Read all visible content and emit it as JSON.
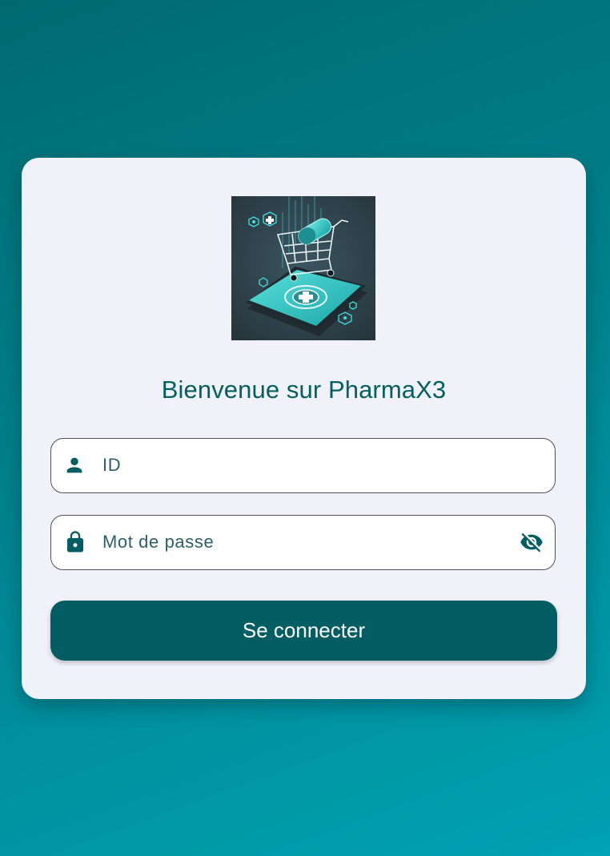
{
  "colors": {
    "background_start": "#006a70",
    "background_end": "#00a2b4",
    "card": "#f1f1fa",
    "primary": "#035e63",
    "title_text": "#03605f"
  },
  "logo": {
    "icon": "pharmacy-cart-phone-logo"
  },
  "welcome_title": "Bienvenue sur PharmaX3",
  "id_field": {
    "icon": "person-icon",
    "placeholder": "ID",
    "value": ""
  },
  "password_field": {
    "icon": "lock-icon",
    "placeholder": "Mot de passe",
    "value": "",
    "visibility_icon": "eye-off-icon"
  },
  "login_button": {
    "label": "Se connecter"
  }
}
